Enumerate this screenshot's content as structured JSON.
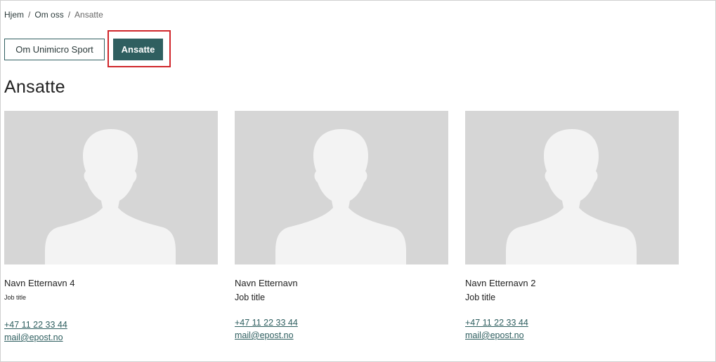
{
  "breadcrumb": {
    "items": [
      {
        "label": "Hjem"
      },
      {
        "label": "Om oss"
      },
      {
        "label": "Ansatte"
      }
    ],
    "separator": "/"
  },
  "tabs": {
    "items": [
      {
        "label": "Om Unimicro Sport",
        "active": false
      },
      {
        "label": "Ansatte",
        "active": true
      }
    ]
  },
  "page": {
    "title": "Ansatte"
  },
  "employees": [
    {
      "name": "Navn Etternavn 4",
      "job_title": "Job title",
      "phone": "+47 11 22 33 44",
      "email": "mail@epost.no"
    },
    {
      "name": "Navn Etternavn",
      "job_title": "Job title",
      "phone": "+47 11 22 33 44",
      "email": "mail@epost.no"
    },
    {
      "name": "Navn Etternavn 2",
      "job_title": "Job title",
      "phone": "+47 11 22 33 44",
      "email": "mail@epost.no"
    }
  ],
  "colors": {
    "accent": "#2f5f60",
    "highlight": "#d0262b",
    "placeholder_bg": "#d6d6d6",
    "placeholder_fg": "#f3f3f3"
  }
}
